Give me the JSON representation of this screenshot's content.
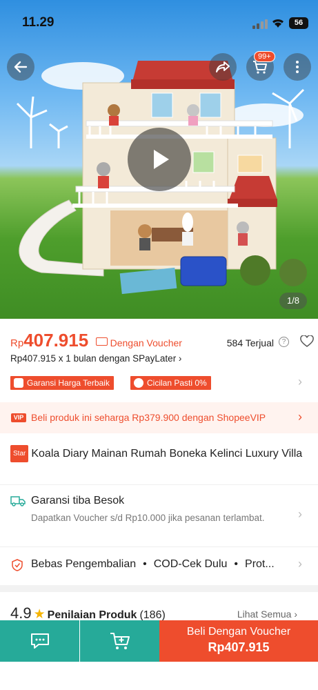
{
  "status_bar": {
    "time": "11.29",
    "battery": "56"
  },
  "header": {
    "cart_badge": "99+"
  },
  "media": {
    "counter": "1/8"
  },
  "price": {
    "currency": "Rp",
    "amount": "407.915",
    "voucher_label": "Dengan Voucher",
    "sold": "584 Terjual",
    "paylater": "Rp407.915 x 1 bulan dengan SPayLater ›"
  },
  "tags": [
    {
      "label": "Garansi Harga Terbaik"
    },
    {
      "label": "Cicilan Pasti 0%"
    }
  ],
  "vip": {
    "logo": "VIP",
    "text": "Beli produk ini seharga Rp379.900 dengan ShopeeVIP"
  },
  "product": {
    "badge": "Star",
    "title": "Koala Diary Mainan Rumah Boneka Kelinci Luxury Villa"
  },
  "shipping": {
    "title": "Garansi tiba Besok",
    "subtitle": "Dapatkan Voucher s/d Rp10.000 jika pesanan terlambat."
  },
  "guarantees": [
    "Bebas Pengembalian",
    "COD-Cek Dulu",
    "Prot..."
  ],
  "rating": {
    "score": "4.9",
    "label": "Penilaian Produk",
    "count": "(186)",
    "see_all": "Lihat Semua ›"
  },
  "bottom_bar": {
    "buy_label": "Beli Dengan Voucher",
    "buy_price": "Rp407.915"
  },
  "colors": {
    "brand": "#ee4d2d",
    "chat_green": "#26aa99",
    "star": "#f6b400"
  }
}
